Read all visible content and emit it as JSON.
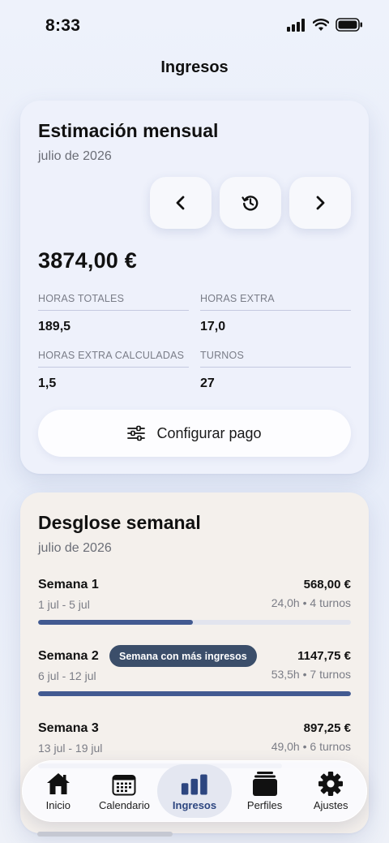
{
  "status_bar": {
    "time": "8:33"
  },
  "page_title": "Ingresos",
  "estimate": {
    "title": "Estimación mensual",
    "month": "julio de 2026",
    "amount": "3874,00 €",
    "stats": [
      {
        "label": "HORAS TOTALES",
        "value": "189,5"
      },
      {
        "label": "HORAS EXTRA",
        "value": "17,0"
      },
      {
        "label": "HORAS EXTRA CALCULADAS",
        "value": "1,5"
      },
      {
        "label": "TURNOS",
        "value": "27"
      }
    ],
    "config_button": "Configurar pago"
  },
  "weekly": {
    "title": "Desglose semanal",
    "month": "julio de 2026",
    "weeks": [
      {
        "name": "Semana 1",
        "range": "1 jul - 5 jul",
        "amount": "568,00 €",
        "meta": "24,0h • 4 turnos",
        "progress": 0.495
      },
      {
        "name": "Semana 2",
        "range": "6 jul - 12 jul",
        "amount": "1147,75 €",
        "meta": "53,5h • 7 turnos",
        "progress": 1.0,
        "badge": "Semana con más ingresos"
      },
      {
        "name": "Semana 3",
        "range": "13 jul - 19 jul",
        "amount": "897,25 €",
        "meta": "49,0h • 6 turnos",
        "progress": 0.78
      }
    ]
  },
  "tabs": [
    {
      "label": "Inicio",
      "icon": "house-icon"
    },
    {
      "label": "Calendario",
      "icon": "calendar-icon"
    },
    {
      "label": "Ingresos",
      "icon": "bar-chart-icon",
      "active": true
    },
    {
      "label": "Perfiles",
      "icon": "stack-icon"
    },
    {
      "label": "Ajustes",
      "icon": "gear-icon"
    }
  ],
  "colors": {
    "accent": "#425a91",
    "badge": "#3b4e6a",
    "active_tab": "#2d4680"
  }
}
